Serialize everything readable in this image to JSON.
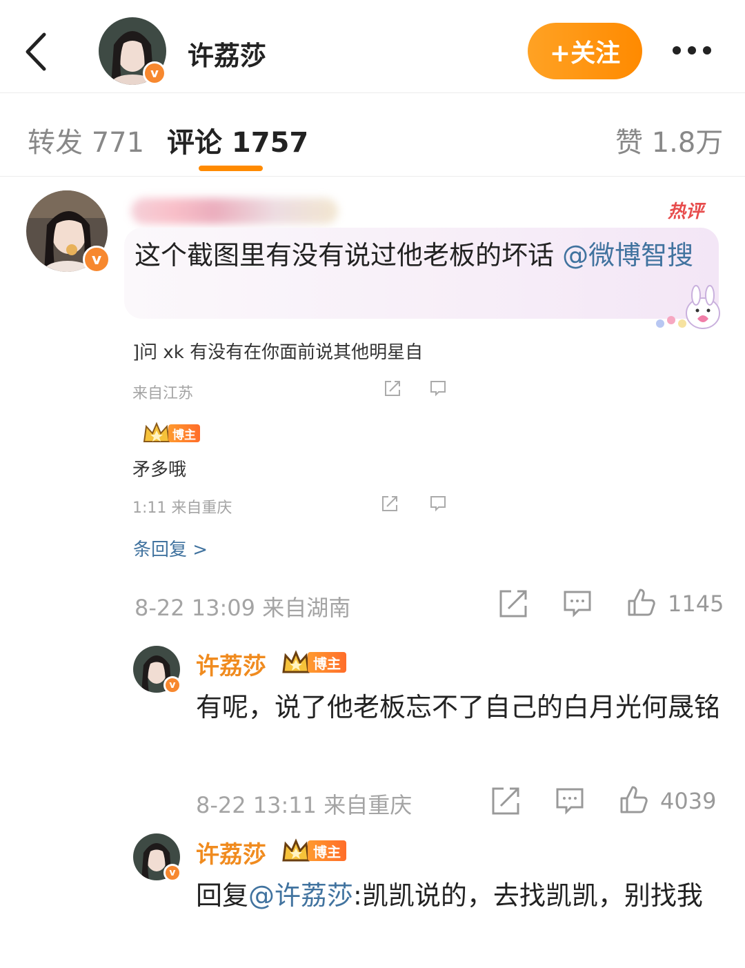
{
  "header": {
    "name": "许荔莎",
    "follow_label": "+关注"
  },
  "tabs": [
    {
      "label": "转发 771"
    },
    {
      "label": "评论 1757"
    },
    {
      "label": "赞 1.8万"
    }
  ],
  "comment": {
    "hot_tag": "热评",
    "text": "这个截图里有没有说过他老板的坏话 ",
    "mention": "@微博智搜",
    "quoted": [
      {
        "text": "]问 xk 有没有在你面前说其他明星自",
        "meta": "来自江苏"
      },
      {
        "text": "矛多哦",
        "meta": "1:11  来自重庆",
        "badge": "博主"
      }
    ],
    "more_replies": "条回复 >",
    "meta": "8-22 13:09  来自湖南",
    "likes": "1145"
  },
  "replies": [
    {
      "name": "许荔莎",
      "badge": "博主",
      "text": "有呢，说了他老板忘不了自己的白月光何晟铭",
      "meta": "8-22 13:11  来自重庆",
      "likes": "4039"
    },
    {
      "name": "许荔莎",
      "badge": "博主",
      "prefix": "回复",
      "mention": "@许荔莎",
      "text": ":凯凯说的，去找凯凯，别找我"
    }
  ],
  "colors": {
    "accent": "#ff8a00",
    "link": "#41739f",
    "name_orange": "#f08b1f",
    "verified": "#f7882f"
  }
}
